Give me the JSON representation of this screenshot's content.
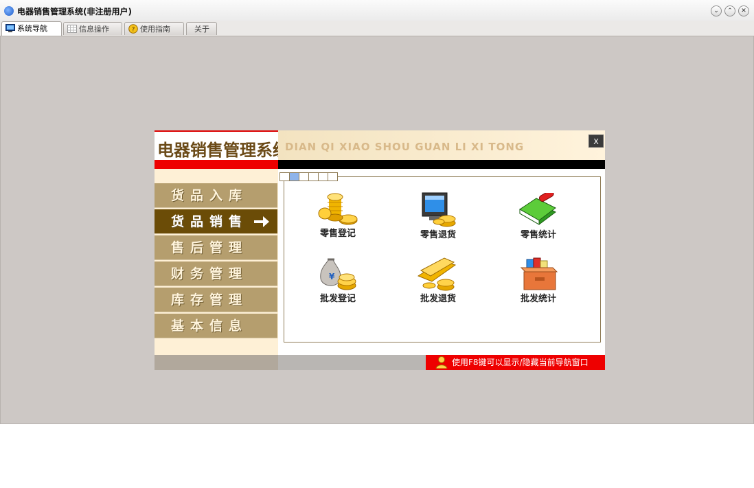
{
  "window": {
    "title": "电器销售管理系统(非注册用户)",
    "controls": {
      "minimize": "⌄",
      "maximize": "⌃",
      "close": "✕"
    }
  },
  "tabs": [
    {
      "label": "系统导航",
      "icon": "monitor-icon",
      "active": true
    },
    {
      "label": "信息操作",
      "icon": "grid-icon",
      "active": false
    },
    {
      "label": "使用指南",
      "icon": "help-icon",
      "active": false
    },
    {
      "label": "关于",
      "icon": "",
      "active": false
    }
  ],
  "panel": {
    "title": "电器销售管理系统",
    "pinyin": "DIAN QI XIAO SHOU GUAN LI XI TONG",
    "close_label": "X",
    "nav": [
      {
        "label": "货品入库",
        "active": false
      },
      {
        "label": "货品销售",
        "active": true
      },
      {
        "label": "售后管理",
        "active": false
      },
      {
        "label": "财务管理",
        "active": false
      },
      {
        "label": "库存管理",
        "active": false
      },
      {
        "label": "基本信息",
        "active": false
      }
    ],
    "functions": [
      {
        "label": "零售登记",
        "icon": "gold-coins-icon"
      },
      {
        "label": "零售退货",
        "icon": "monitor-coins-icon"
      },
      {
        "label": "零售统计",
        "icon": "green-book-icon"
      },
      {
        "label": "批发登记",
        "icon": "money-bag-icon"
      },
      {
        "label": "批发退货",
        "icon": "gold-bars-icon"
      },
      {
        "label": "批发统计",
        "icon": "file-box-icon"
      }
    ],
    "pager_pages": 6,
    "pager_selected": 2,
    "footer_hint": "使用F8键可以显示/隐藏当前导航窗口"
  },
  "colors": {
    "title_brown": "#6b4a17",
    "nav_item": "#b59e6e",
    "nav_active": "#6b4c07",
    "footer_red": "#ee0000"
  }
}
